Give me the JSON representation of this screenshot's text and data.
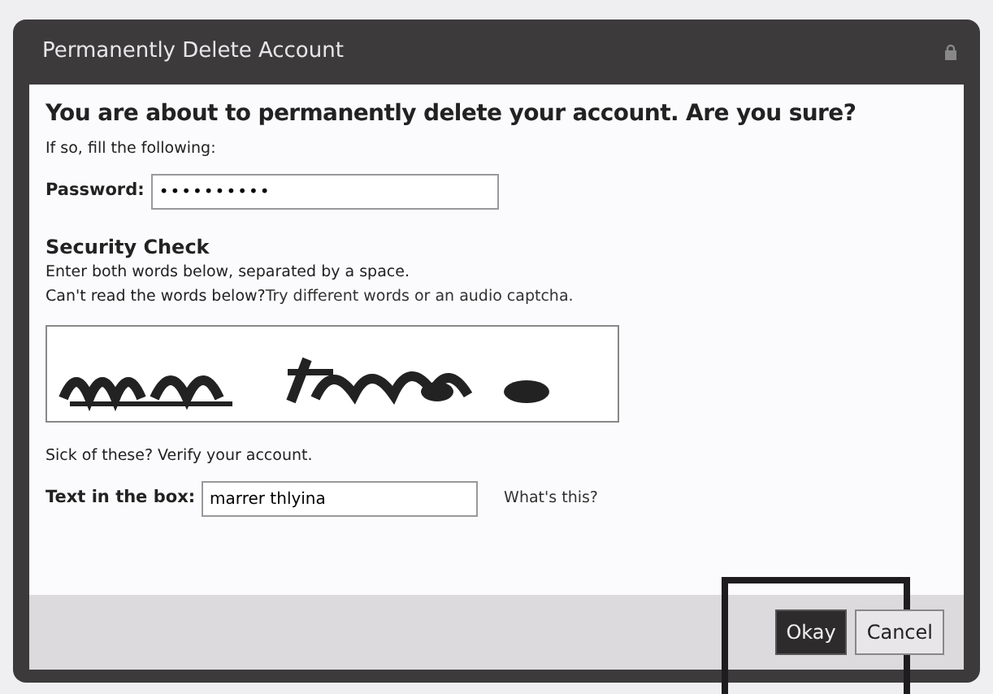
{
  "dialog": {
    "title": "Permanently Delete Account",
    "heading": "You are about to permanently delete your account. Are you sure?",
    "intro": "If so, fill the following:",
    "password": {
      "label": "Password:",
      "value": "••••••••••"
    },
    "security_check": {
      "title": "Security Check",
      "instructions": "Enter both words below, separated by a space.",
      "help": "Can't read the words below?",
      "help_link": "Try different words or an audio captcha.",
      "verify_text": "Sick of these? Verify your account.",
      "answer": {
        "label": "Text in the box:",
        "value": "marrer thlyina"
      },
      "whats_this": "What's this?"
    },
    "buttons": [
      {
        "label": "Okay",
        "kind": "primary",
        "highlighted": true
      },
      {
        "label": "Cancel",
        "kind": "secondary",
        "highlighted": false
      }
    ]
  }
}
